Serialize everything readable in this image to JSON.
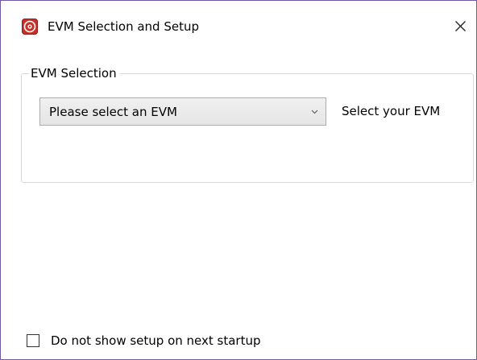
{
  "window": {
    "title": "EVM Selection and Setup",
    "app_icon": "app-logo-icon",
    "close_icon": "close-icon",
    "border_color": "#6e5aa6"
  },
  "evm_selection": {
    "group_title": "EVM Selection",
    "dropdown": {
      "value": "Please select an EVM",
      "icon": "chevron-down-icon"
    },
    "hint_label": "Select your EVM"
  },
  "footer": {
    "checkbox_label": "Do not show setup on next startup",
    "checked": false
  },
  "colors": {
    "accent_red": "#c8312a"
  }
}
